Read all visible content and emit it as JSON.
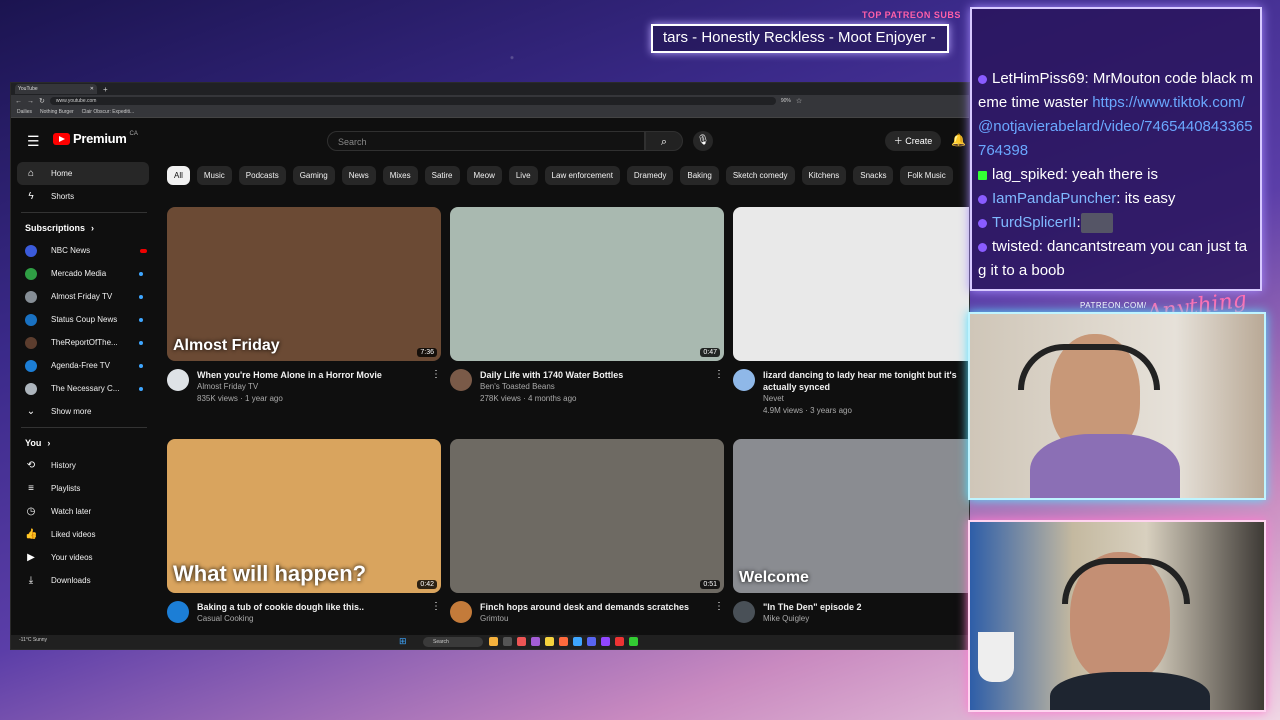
{
  "overlay": {
    "patron_label": "TOP PATREON SUBS",
    "ticker_text": "tars - Honestly Reckless - Moot Enjoyer -",
    "patreon_url": "PATREON.COM/",
    "signature": "Anything Else"
  },
  "browser": {
    "tab_title": "YouTube",
    "url": "www.youtube.com",
    "zoom": "90%",
    "bookmarks": [
      "Dailies",
      "Nothing Burger",
      "Clair Obscur: Expediti..."
    ]
  },
  "youtube": {
    "logo_text": "Premium",
    "logo_region": "CA",
    "search_placeholder": "Search",
    "create_label": "Create",
    "sidebar": {
      "home": "Home",
      "shorts": "Shorts",
      "subscriptions_heading": "Subscriptions",
      "subscriptions": [
        {
          "name": "NBC News",
          "color": "#3b5bdb",
          "indicator": "live"
        },
        {
          "name": "Mercado Media",
          "color": "#2f9e44",
          "indicator": "dot"
        },
        {
          "name": "Almost Friday TV",
          "color": "#868e96",
          "indicator": "dot"
        },
        {
          "name": "Status Coup News",
          "color": "#1971c2",
          "indicator": "dot"
        },
        {
          "name": "TheReportOfThe...",
          "color": "#5c3d2e",
          "indicator": "dot"
        },
        {
          "name": "Agenda-Free TV",
          "color": "#1c7ed6",
          "indicator": "dot"
        },
        {
          "name": "The Necessary C...",
          "color": "#adb5bd",
          "indicator": "dot"
        }
      ],
      "show_more": "Show more",
      "you_heading": "You",
      "you_items": [
        {
          "label": "History",
          "icon": "history-icon"
        },
        {
          "label": "Playlists",
          "icon": "playlists-icon"
        },
        {
          "label": "Watch later",
          "icon": "watch-later-icon"
        },
        {
          "label": "Liked videos",
          "icon": "liked-videos-icon"
        },
        {
          "label": "Your videos",
          "icon": "your-videos-icon"
        },
        {
          "label": "Downloads",
          "icon": "downloads-icon"
        }
      ]
    },
    "chips": [
      "All",
      "Music",
      "Podcasts",
      "Gaming",
      "News",
      "Mixes",
      "Satire",
      "Meow",
      "Live",
      "Law enforcement",
      "Dramedy",
      "Baking",
      "Sketch comedy",
      "Kitchens",
      "Snacks",
      "Folk Music"
    ],
    "videos": [
      {
        "title": "When you're Home Alone in a Horror Movie",
        "channel": "Almost Friday TV",
        "stats": "835K views · 1 year ago",
        "duration": "7:36",
        "overlay": "Almost Friday",
        "thumb": "#6b4a34",
        "avatar": "#dee2e6"
      },
      {
        "title": "Daily Life with 1740 Water Bottles",
        "channel": "Ben's Toasted Beans",
        "stats": "278K views · 4 months ago",
        "duration": "0:47",
        "overlay": "",
        "thumb": "#a9b9b0",
        "avatar": "#7a5a48"
      },
      {
        "title": "lizard dancing to lady hear me tonight but it's actually synced",
        "channel": "Nevet",
        "stats": "4.9M views · 3 years ago",
        "duration": "",
        "overlay": "",
        "thumb": "#e9e9e9",
        "avatar": "#8fb8e8"
      },
      {
        "title": "Baking a tub of cookie dough like this..",
        "channel": "Casual Cooking",
        "stats": "",
        "duration": "0:42",
        "overlay": "What will happen?",
        "thumb": "#d9a45e",
        "avatar": "#1c7ed6"
      },
      {
        "title": "Finch hops around desk and demands scratches",
        "channel": "Grimtou",
        "stats": "",
        "duration": "0:51",
        "overlay": "",
        "thumb": "#6e6a63",
        "avatar": "#c47b3a"
      },
      {
        "title": "\"In The Den\" episode 2",
        "channel": "Mike Quigley",
        "stats": "",
        "duration": "",
        "overlay": "Welcome",
        "thumb": "#8a8c91",
        "avatar": "#495057"
      }
    ]
  },
  "chat": [
    {
      "user": "LetHimPiss69",
      "text": ": MrMouton code black meme time waster ",
      "link": "https://www.tiktok.com/@notjavierabelard/video/7465440843365764398",
      "badge": "purple",
      "user_color": "#ffffff"
    },
    {
      "user": "lag_spiked",
      "text": ": yeah there is",
      "link": "",
      "badge": "green",
      "user_color": "#ffffff"
    },
    {
      "user": "IamPandaPuncher",
      "text": ": its easy",
      "link": "",
      "badge": "purple",
      "user_color": "#7fb8ff"
    },
    {
      "user": "TurdSplicerII",
      "text": ":",
      "link": "",
      "badge": "purple",
      "user_color": "#7fb8ff",
      "emote": true
    },
    {
      "user": "twisted",
      "text": ": dancantstream you can just tag it to a boob",
      "link": "",
      "badge": "purple",
      "user_color": "#ffffff"
    }
  ],
  "taskbar": {
    "search": "Search",
    "weather": "-11°C Sunny"
  }
}
